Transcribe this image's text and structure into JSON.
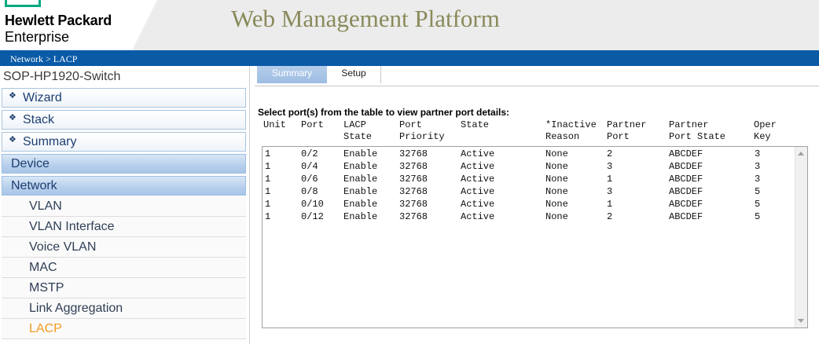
{
  "header": {
    "logo_line1": "Hewlett Packard",
    "logo_line2": "Enterprise",
    "logo_accent_color": "#01a982",
    "app_title": "Web Management Platform",
    "breadcrumb": "Network > LACP"
  },
  "sidebar": {
    "device_name": "SOP-HP1920-Switch",
    "top_items": [
      {
        "label": "Wizard"
      },
      {
        "label": "Stack"
      },
      {
        "label": "Summary"
      }
    ],
    "sections": [
      {
        "label": "Device"
      },
      {
        "label": "Network"
      }
    ],
    "network_items": [
      {
        "label": "VLAN"
      },
      {
        "label": "VLAN Interface"
      },
      {
        "label": "Voice VLAN"
      },
      {
        "label": "MAC"
      },
      {
        "label": "MSTP"
      },
      {
        "label": "Link Aggregation"
      },
      {
        "label": "LACP"
      }
    ],
    "active_item": "LACP",
    "active_color": "#f39a1e"
  },
  "tabs": [
    {
      "label": "Summary",
      "selected": true
    },
    {
      "label": "Setup",
      "selected": false
    }
  ],
  "main": {
    "instruction": "Select port(s) from the table to view partner port details:",
    "columns": [
      {
        "line1": "",
        "line2": "Unit"
      },
      {
        "line1": "",
        "line2": "Port"
      },
      {
        "line1": "LACP",
        "line2": "State"
      },
      {
        "line1": "Port",
        "line2": "Priority"
      },
      {
        "line1": "",
        "line2": "State"
      },
      {
        "line1": "*Inactive",
        "line2": "Reason"
      },
      {
        "line1": "Partner",
        "line2": "Port"
      },
      {
        "line1": "Partner",
        "line2": "Port State"
      },
      {
        "line1": "Oper",
        "line2": "Key"
      }
    ],
    "rows": [
      [
        "1",
        "0/2",
        "Enable",
        "32768",
        "Active",
        "None",
        "2",
        "ABCDEF",
        "3"
      ],
      [
        "1",
        "0/4",
        "Enable",
        "32768",
        "Active",
        "None",
        "3",
        "ABCDEF",
        "3"
      ],
      [
        "1",
        "0/6",
        "Enable",
        "32768",
        "Active",
        "None",
        "1",
        "ABCDEF",
        "3"
      ],
      [
        "1",
        "0/8",
        "Enable",
        "32768",
        "Active",
        "None",
        "3",
        "ABCDEF",
        "5"
      ],
      [
        "1",
        "0/10",
        "Enable",
        "32768",
        "Active",
        "None",
        "1",
        "ABCDEF",
        "5"
      ],
      [
        "1",
        "0/12",
        "Enable",
        "32768",
        "Active",
        "None",
        "2",
        "ABCDEF",
        "5"
      ]
    ]
  }
}
